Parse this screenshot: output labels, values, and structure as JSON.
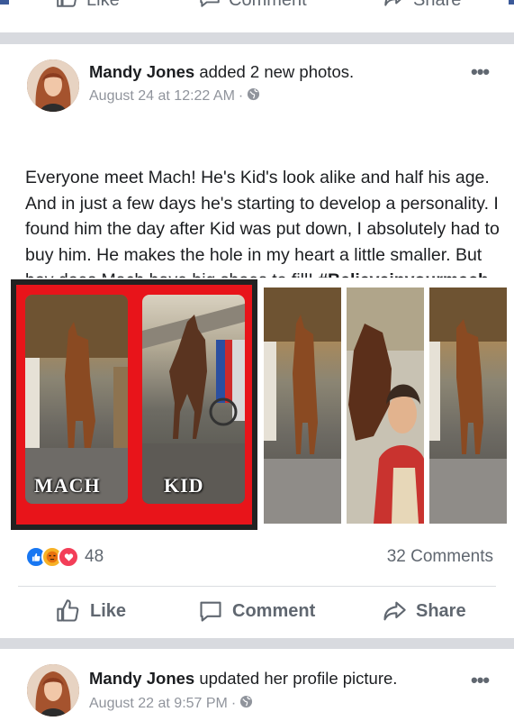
{
  "previous_post_actions": {
    "like": "Like",
    "comment": "Comment",
    "share": "Share"
  },
  "post": {
    "author": "Mandy Jones",
    "action": "added 2 new photos.",
    "date": "August 24 at 12:22 AM",
    "meta_sep": "·",
    "privacy_icon": "globe-icon",
    "text": "Everyone meet Mach! He's Kid's look alike and half his age. And in just a few days he's starting to develop a personality. I found him the day after Kid was put down, I absolutely had to buy him. He makes the hole in my heart a little smaller. But boy does Mach have big shoes to fill!",
    "hashtag": "#Believeinyourmach",
    "collage_labels": [
      "MACH",
      "KID"
    ],
    "reaction_icons": [
      "like-reaction-icon",
      "angry-reaction-icon",
      "love-reaction-icon"
    ],
    "reactions_count": "48",
    "comments_count": "32 Comments",
    "actions": {
      "like": "Like",
      "comment": "Comment",
      "share": "Share"
    }
  },
  "next_post": {
    "author": "Mandy Jones",
    "action": "updated her profile picture.",
    "date": "August 22 at 9:57 PM",
    "meta_sep": "·",
    "privacy_icon": "globe-icon"
  },
  "colors": {
    "brand": "#3b5998",
    "text": "#1c1e21",
    "secondary": "#606770",
    "meta": "#90949c",
    "separator": "#d8dadf",
    "like_blue": "#1877f2",
    "angry_orange": "#f7b125",
    "love_red": "#f33e58",
    "collage_red": "#e8141a"
  }
}
